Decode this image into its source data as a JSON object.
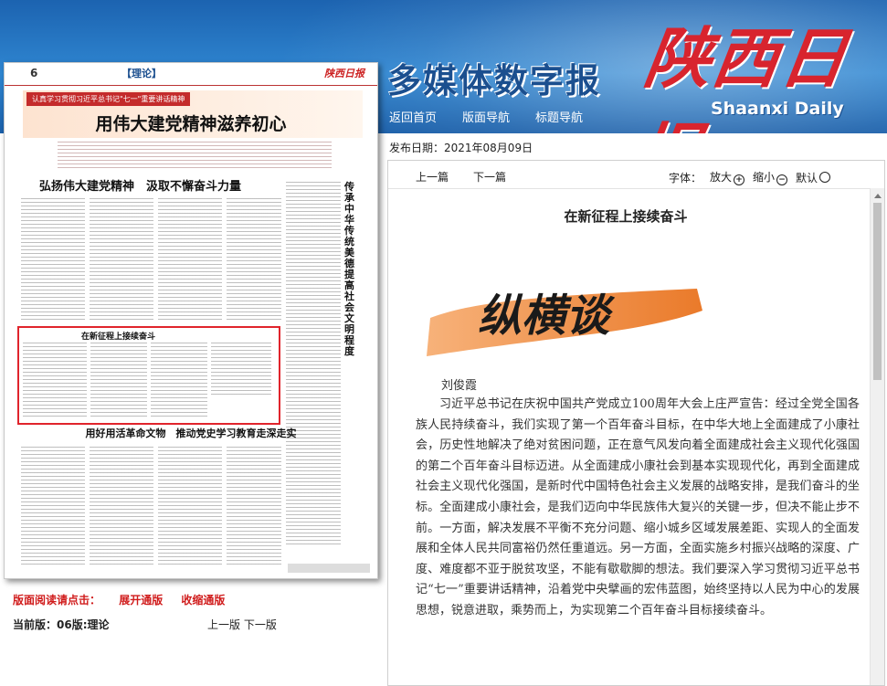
{
  "header": {
    "subtitle": "多媒体数字报",
    "logo_text": "陕西日报",
    "logo_en": "Shaanxi Daily",
    "nav": [
      "返回首页",
      "版面导航",
      "标题导航"
    ]
  },
  "thumbnail": {
    "page_number": "6",
    "section": "【理论】",
    "paper_logo": "陕西日报",
    "tag": "认真学习贯彻习近平总书记\"七一\"重要讲话精神",
    "headline": "用伟大建党精神滋养初心",
    "headline2": "弘扬伟大建党精神　汲取不懈奋斗力量",
    "vertical_headline": "传承中华传统美德　提高社会文明程度",
    "selected_title": "在新征程上接续奋斗",
    "headline3": "用好用活革命文物　推动党史学习教育走深走实"
  },
  "sidebar": {
    "expand_label": "版面阅读请点击：",
    "expand_link": "展开通版",
    "collapse_link": "收缩通版",
    "current_label": "当前版：06版:理论",
    "prev_page": "上一版",
    "next_page": "下一版"
  },
  "article": {
    "pub_date": "发布日期：2021年08月09日",
    "prev_article": "上一篇",
    "next_article": "下一篇",
    "font_label": "字体：",
    "font_larger": "放大",
    "font_smaller": "缩小",
    "font_default": "默认",
    "title": "在新征程上接续奋斗",
    "column_name": "纵横谈",
    "author": "刘俊霞",
    "body": "习近平总书记在庆祝中国共产党成立100周年大会上庄严宣告：经过全党全国各族人民持续奋斗，我们实现了第一个百年奋斗目标，在中华大地上全面建成了小康社会，历史性地解决了绝对贫困问题，正在意气风发向着全面建成社会主义现代化强国的第二个百年奋斗目标迈进。从全面建成小康社会到基本实现现代化，再到全面建成社会主义现代化强国，是新时代中国特色社会主义发展的战略安排，是我们奋斗的坐标。全面建成小康社会，是我们迈向中华民族伟大复兴的关键一步，但决不能止步不前。一方面，解决发展不平衡不充分问题、缩小城乡区域发展差距、实现人的全面发展和全体人民共同富裕仍然任重道远。另一方面，全面实施乡村振兴战略的深度、广度、难度都不亚于脱贫攻坚，不能有歇歇脚的想法。我们要深入学习贯彻习近平总书记“七一”重要讲话精神，沿着党中央擘画的宏伟蓝图，始终坚持以人民为中心的发展思想，锐意进取，乘势而上，为实现第二个百年奋斗目标接续奋斗。"
  },
  "colors": {
    "banner_blue": "#2f86d1",
    "logo_red": "#d8242e",
    "link_red": "#d01c1c",
    "brush_orange": "#ef8a3c"
  }
}
